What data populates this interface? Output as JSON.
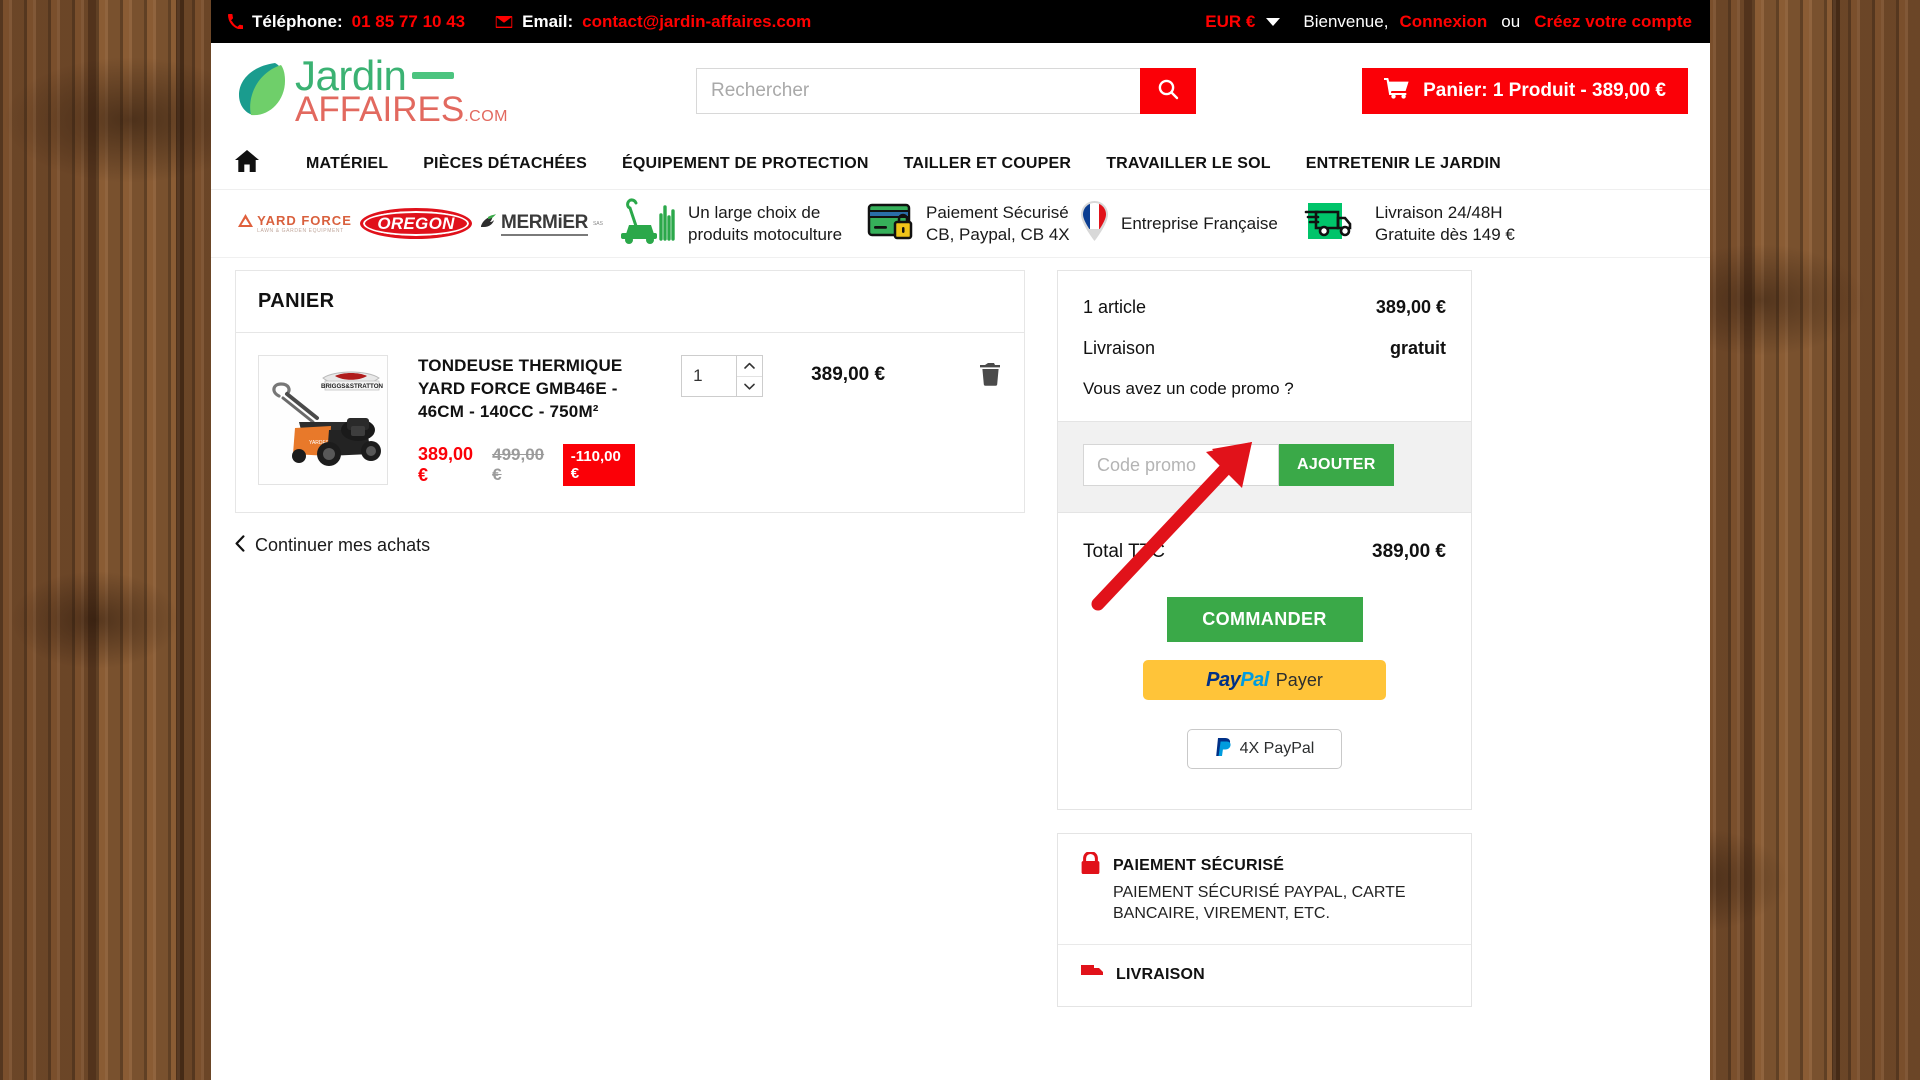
{
  "topbar": {
    "phone_label": "Téléphone:",
    "phone_value": "01 85 77 10 43",
    "email_label": "Email:",
    "email_value": "contact@jardin-affaires.com",
    "currency": "EUR €",
    "welcome": "Bienvenue,",
    "login": "Connexion",
    "or": "ou",
    "register": "Créez votre compte"
  },
  "header": {
    "logo_primary": "Jardin",
    "logo_secondary": "AFFAIRES",
    "logo_tld": ".COM",
    "search_placeholder": "Rechercher",
    "search_value": "",
    "cart_label": "Panier: 1 Produit - 389,00 €"
  },
  "nav": {
    "home_label": "Accueil",
    "items": [
      {
        "label": "MATÉRIEL"
      },
      {
        "label": "PIÈCES DÉTACHÉES"
      },
      {
        "label": "ÉQUIPEMENT DE PROTECTION"
      },
      {
        "label": "TAILLER ET COUPER"
      },
      {
        "label": "TRAVAILLER LE SOL"
      },
      {
        "label": "ENTRETENIR LE JARDIN"
      }
    ]
  },
  "trust": {
    "brands": [
      {
        "name": "YARD FORCE",
        "tagline": "LAWN & GARDEN EQUIPMENT"
      },
      {
        "name": "OREGON"
      },
      {
        "name": "MERMiER",
        "sup": "SAS"
      }
    ],
    "items": [
      {
        "line1": "Un large choix de",
        "line2": "produits motoculture"
      },
      {
        "line1": "Paiement Sécurisé",
        "line2": "CB, Paypal, CB 4X"
      },
      {
        "line1": "Entreprise Française",
        "line2": ""
      },
      {
        "line1": "Livraison 24/48H",
        "line2": "Gratuite dès 149 €"
      }
    ]
  },
  "cart": {
    "panel_title": "PANIER",
    "items": [
      {
        "title": "TONDEUSE THERMIQUE YARD FORCE GMB46E - 46CM - 140CC - 750M²",
        "price_now": "389,00 €",
        "price_old": "499,00 €",
        "discount": "-110,00 €",
        "quantity": "1",
        "line_total": "389,00 €",
        "image_alt": "Tondeuse thermique Yard Force GMB46E avec moteur Briggs & Stratton"
      }
    ],
    "continue_label": "Continuer mes achats"
  },
  "summary": {
    "items_label": "1 article",
    "items_value": "389,00 €",
    "shipping_label": "Livraison",
    "shipping_value": "gratuit",
    "promo_question": "Vous avez un code promo ?",
    "promo_placeholder": "Code promo",
    "promo_value": "",
    "promo_button": "AJOUTER",
    "total_label": "Total TTC",
    "total_value": "389,00 €",
    "order_button": "COMMANDER",
    "paypal_button": "Payer",
    "paypal_brand_pay": "Pay",
    "paypal_brand_pal": "Pal",
    "paypal4x_button": "4X PayPal"
  },
  "info": [
    {
      "title": "PAIEMENT SÉCURISÉ",
      "desc": "PAIEMENT SÉCURISÉ PAYPAL, CARTE BANCAIRE, VIREMENT, ETC.",
      "icon": "lock-icon"
    },
    {
      "title": "LIVRAISON",
      "desc": "",
      "icon": "truck-icon"
    }
  ],
  "colors": {
    "accent_red": "#fb0007",
    "green": "#3aa948",
    "paypal_yellow": "#ffc439",
    "annotation_red": "#e1121a"
  }
}
